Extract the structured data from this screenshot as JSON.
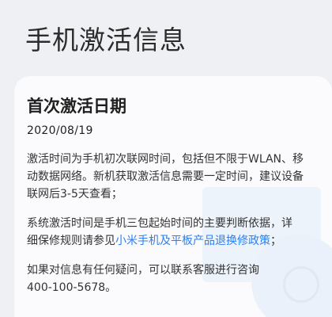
{
  "page": {
    "title": "手机激活信息"
  },
  "card": {
    "title": "首次激活日期",
    "date": "2020/08/19",
    "paragraph1": {
      "line1": "激活时间为手机初次联网时间，包括但不限于WLAN、移",
      "line2": "动数据网络。新机获取激活信息需要一定时间，建议设备",
      "line3": "联网后3-5天查看；"
    },
    "paragraph2": {
      "line1": "系统激活时间是手机三包起始时间的主要判断依据，详",
      "line2_prefix": "细保修规则请参见",
      "link": "小米手机及平板产品退换修政策",
      "line2_suffix": "；"
    },
    "paragraph3": {
      "line1": "如果对信息有任何疑问，可以联系客服进行咨询",
      "line2": "400-100-5678。"
    }
  },
  "colors": {
    "background": "#eef0f4",
    "card": "#fbfbfd",
    "link": "#2d7ff0"
  }
}
